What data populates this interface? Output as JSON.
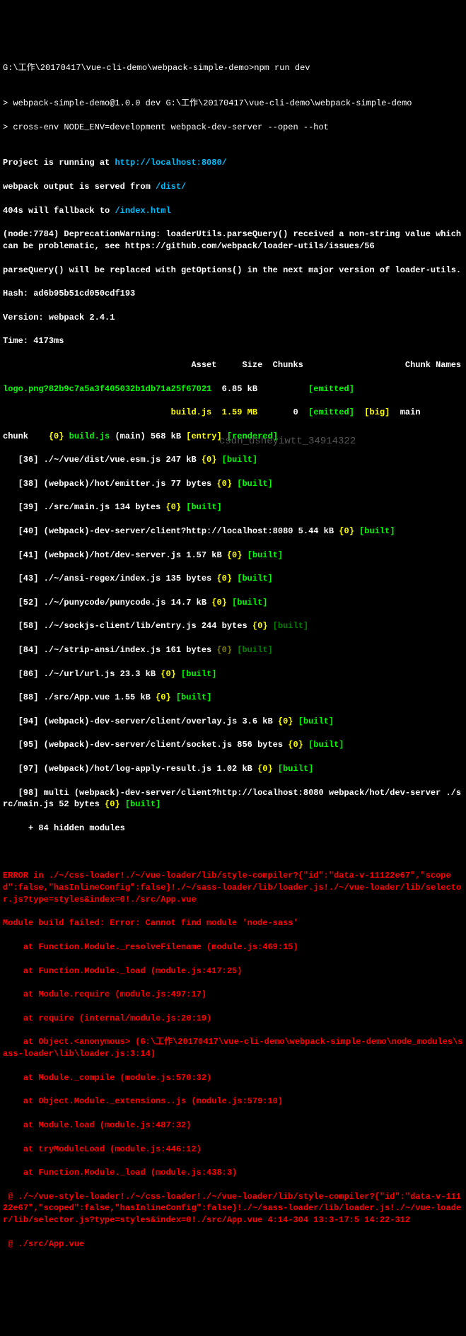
{
  "lines": {
    "cmd1": "G:\\工作\\20170417\\vue-cli-demo\\webpack-simple-demo>npm run dev",
    "blank1": "",
    "cmd2": "> webpack-simple-demo@1.0.0 dev G:\\工作\\20170417\\vue-cli-demo\\webpack-simple-demo",
    "cmd3": "> cross-env NODE_ENV=development webpack-dev-server --open --hot",
    "blank2": "",
    "proj_running_pre": "Project is running at ",
    "proj_running_url": "http://localhost:8080/",
    "output_from_pre": "webpack output is served from ",
    "output_from_path": "/dist/",
    "fallback_pre": "404s will fallback to ",
    "fallback_path": "/index.html",
    "dep1": "(node:7784) DeprecationWarning: loaderUtils.parseQuery() received a non-string value which can be problematic, see https://github.com/webpack/loader-utils/issues/56",
    "dep2": "parseQuery() will be replaced with getOptions() in the next major version of loader-utils.",
    "hash_lbl": "Hash: ",
    "hash_val": "ad6b95b51cd050cdf193",
    "ver_lbl": "Version: webpack ",
    "ver_val": "2.4.1",
    "time_lbl": "Time: ",
    "time_val": "4173",
    "time_unit": "ms",
    "header": "                                     Asset     Size  Chunks                    Chunk Names",
    "asset1_name": "logo.png?82b9c7a5a3f405032b1db71a25f67021",
    "asset1_size": "  6.85 kB          ",
    "asset1_emit": "[emitted]",
    "asset2_name": "                                 build.js",
    "asset2_size": "  1.59 MB",
    "asset2_chunk": "       0  ",
    "asset2_emit": "[emitted]",
    "asset2_big": "  [big]",
    "asset2_tail": "  main",
    "chunk_pre": "chunk    ",
    "chunk_id": "{0} ",
    "chunk_name": "build.js ",
    "chunk_main": "(main) 568 kB ",
    "chunk_entry": "[entry]",
    "chunk_rend": " [rendered]",
    "m36": "   [36] ./~/vue/dist/vue.esm.js 247 kB ",
    "m38": "   [38] (webpack)/hot/emitter.js 77 bytes ",
    "m39": "   [39] ./src/main.js 134 bytes ",
    "m40": "   [40] (webpack)-dev-server/client?http://localhost:8080 5.44 kB ",
    "m41": "   [41] (webpack)/hot/dev-server.js 1.57 kB ",
    "m43": "   [43] ./~/ansi-regex/index.js 135 bytes ",
    "m52": "   [52] ./~/punycode/punycode.js 14.7 kB ",
    "m58": "   [58] ./~/sockjs-client/lib/entry.js 244 bytes ",
    "m84": "   [84] ./~/strip-ansi/index.js 161 bytes ",
    "m86": "   [86] ./~/url/url.js 23.3 kB ",
    "m88": "   [88] ./src/App.vue 1.55 kB ",
    "m94": "   [94] (webpack)-dev-server/client/overlay.js 3.6 kB ",
    "m95": "   [95] (webpack)-dev-server/client/socket.js 856 bytes ",
    "m97": "   [97] (webpack)/hot/log-apply-result.js 1.02 kB ",
    "m98a": "   [98] multi (webpack)-dev-server/client?http://localhost:8080 webpack/hot/dev-server ./src/main.js",
    "m98b": " 52 bytes ",
    "zero": "{0}",
    "built": " [built]",
    "hidden": "     + 84 hidden modules",
    "err1": "ERROR in ./~/css-loader!./~/vue-loader/lib/style-compiler?{\"id\":\"data-v-11122e67\",\"scoped\":false,\"hasInlineConfig\":false}!./~/sass-loader/lib/loader.js!./~/vue-loader/lib/selector.js?type=styles&index=0!./src/App.vue",
    "err2": "Module build failed: Error: Cannot find module 'node-sass'",
    "err3": "    at Function.Module._resolveFilename (module.js:469:15)",
    "err4": "    at Function.Module._load (module.js:417:25)",
    "err5": "    at Module.require (module.js:497:17)",
    "err6": "    at require (internal/module.js:20:19)",
    "err7": "    at Object.<anonymous> (G:\\工作\\20170417\\vue-cli-demo\\webpack-simple-demo\\node_modules\\sass-loader\\lib\\loader.js:3:14)",
    "err8": "    at Module._compile (module.js:570:32)",
    "err9": "    at Object.Module._extensions..js (module.js:579:10)",
    "err10": "    at Module.load (module.js:487:32)",
    "err11": "    at tryModuleLoad (module.js:446:12)",
    "err12": "    at Function.Module._load (module.js:438:3)",
    "err13": " @ ./~/vue-style-loader!./~/css-loader!./~/vue-loader/lib/style-compiler?{\"id\":\"data-v-11122e67\",\"scoped\":false,\"hasInlineConfig\":false}!./~/sass-loader/lib/loader.js!./~/vue-loader/lib/selector.js?type=styles&index=0!./src/App.vue 4:14-304 13:3-17:5 14:22-312",
    "err14": " @ ./src/App.vue",
    "watermark": "csdn_dsheyiwtt_34914322"
  }
}
